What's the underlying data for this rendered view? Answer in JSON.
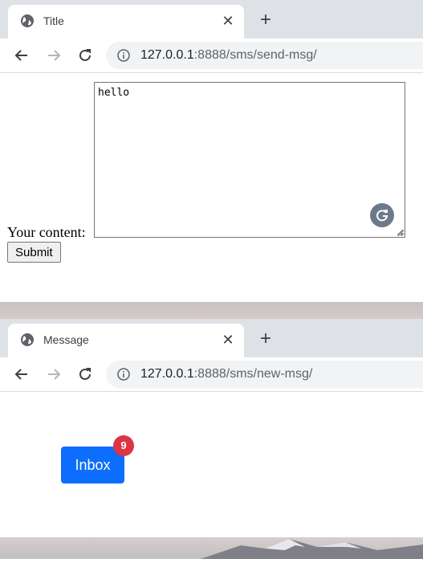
{
  "windows": [
    {
      "tab_title": "Title",
      "url_host": "127.0.0.1",
      "url_rest": ":8888/sms/send-msg/",
      "form": {
        "label": "Your content:",
        "textarea_value": "hello",
        "submit_label": "Submit"
      }
    },
    {
      "tab_title": "Message",
      "url_host": "127.0.0.1",
      "url_rest": ":8888/sms/new-msg/",
      "inbox": {
        "label": "Inbox",
        "badge_count": "9"
      }
    }
  ],
  "icons": {
    "favicon": "globe-icon",
    "close": "close-icon",
    "new_tab": "plus-icon",
    "back": "back-arrow-icon",
    "forward": "forward-arrow-icon",
    "reload": "reload-icon",
    "site_info": "info-icon",
    "grammarly": "grammarly-icon"
  },
  "colors": {
    "tab_strip": "#dee1e6",
    "omnibox": "#f1f3f4",
    "inbox_button": "#0d6efd",
    "badge": "#dc3545",
    "grammarly": "#6c7a89"
  }
}
